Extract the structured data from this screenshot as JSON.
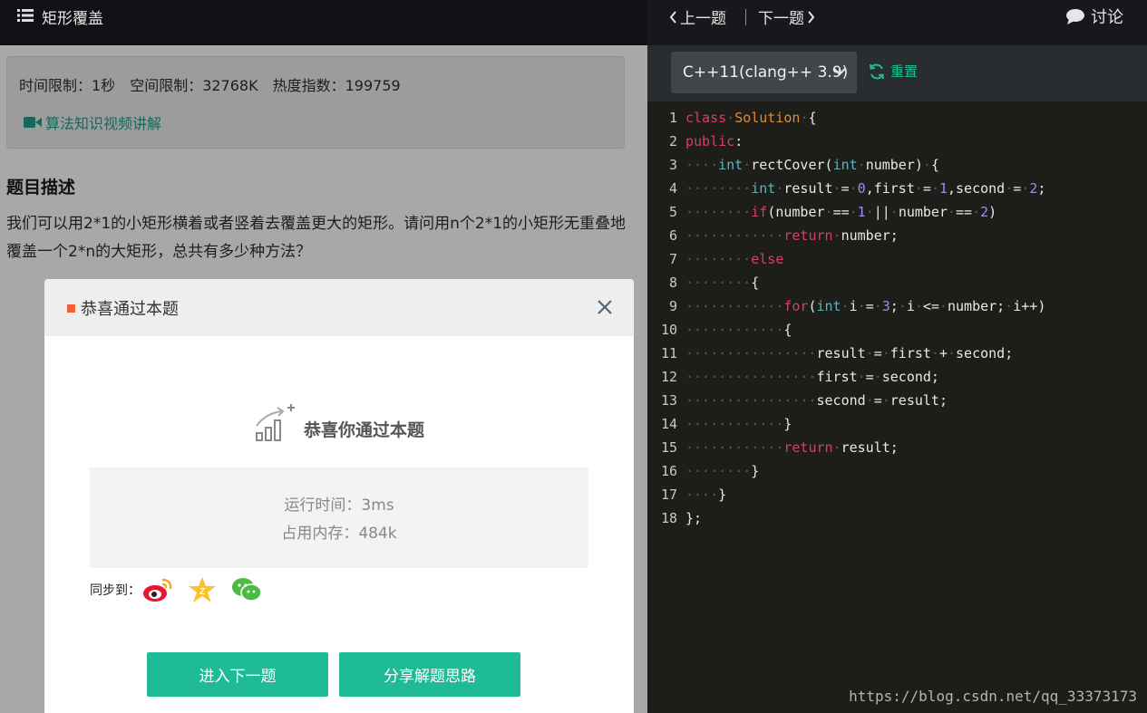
{
  "problem": {
    "title": "矩形覆盖",
    "time_limit": "时间限制：1秒",
    "space_limit": "空间限制：32768K",
    "heat_index": "热度指数：199759",
    "video_link": "算法知识视频讲解",
    "desc_heading": "题目描述",
    "desc_text": "我们可以用2*1的小矩形横着或者竖着去覆盖更大的矩形。请问用n个2*1的小矩形无重叠地覆盖一个2*n的大矩形，总共有多少种方法？"
  },
  "modal": {
    "title": "恭喜通过本题",
    "congrats": "恭喜你通过本题",
    "runtime": "运行时间：3ms",
    "memory": "占用内存：484k",
    "sync_label": "同步到：",
    "next_button": "进入下一题",
    "share_button": "分享解题思路"
  },
  "nav": {
    "prev": "上一题",
    "next": "下一题",
    "discuss": "讨论"
  },
  "editor": {
    "language": "C++11(clang++ 3.9)",
    "reset": "重置",
    "line_numbers": [
      "1",
      "2",
      "3",
      "4",
      "5",
      "6",
      "7",
      "8",
      "9",
      "10",
      "11",
      "12",
      "13",
      "14",
      "15",
      "16",
      "17",
      "18"
    ],
    "lines": [
      "class Solution {",
      "public:",
      "    int rectCover(int number) {",
      "        int result = 0,first = 1,second = 2;",
      "        if(number == 1 || number == 2)",
      "            return number;",
      "        else",
      "        {",
      "            for(int i = 3; i <= number; i++)",
      "            {",
      "                result = first + second;",
      "                first = second;",
      "                second = result;",
      "            }",
      "            return result;",
      "        }",
      "    }",
      "};"
    ]
  },
  "watermark": "https://blog.csdn.net/qq_33373173",
  "colors": {
    "accent": "#1fbb96",
    "keyword": "#d83e6d",
    "type": "#56b6c2",
    "class_name": "#e08a36",
    "number": "#a18be8",
    "modal_marker": "#f0623e"
  },
  "icons": [
    "list-icon",
    "video-camera-icon",
    "close-icon",
    "success-chart-icon",
    "weibo-icon",
    "qzone-icon",
    "wechat-icon",
    "chevron-left-icon",
    "chevron-right-icon",
    "chat-bubble-icon",
    "chevron-down-icon",
    "refresh-icon"
  ]
}
